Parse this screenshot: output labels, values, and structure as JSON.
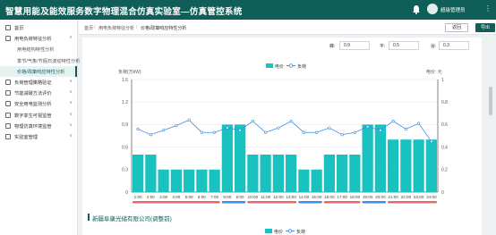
{
  "header": {
    "title": "智慧用能及能效服务数字物理混合仿真实验室—仿真管控系统",
    "user": "超级管理员",
    "bell_icon": "bell-icon",
    "more_icon": "more-icon",
    "color": "#0f5e57"
  },
  "sidebar": {
    "items": [
      {
        "label": "首页",
        "icon": "home-icon",
        "caret": "",
        "sub": false
      },
      {
        "label": "用电负荷特征分析",
        "icon": "chart-icon",
        "caret": "^",
        "sub": false
      },
      {
        "label": "用电结构特性分析",
        "icon": "",
        "caret": "",
        "sub": true
      },
      {
        "label": "季节/气象/节假日波动特性分析",
        "icon": "",
        "caret": "",
        "sub": true
      },
      {
        "label": "价格/政策响应特性分析",
        "icon": "",
        "caret": "",
        "sub": true,
        "active": true
      },
      {
        "label": "负荷管理策略验证",
        "icon": "strategy-icon",
        "caret": "v",
        "sub": false
      },
      {
        "label": "节能减碳方法评价",
        "icon": "leaf-icon",
        "caret": "v",
        "sub": false
      },
      {
        "label": "安全用电监测分析",
        "icon": "shield-icon",
        "caret": "v",
        "sub": false
      },
      {
        "label": "数字孪生可视监管",
        "icon": "monitor-icon",
        "caret": "v",
        "sub": false
      },
      {
        "label": "物理仿真环境监管",
        "icon": "server-icon",
        "caret": "v",
        "sub": false
      },
      {
        "label": "实验室管理",
        "icon": "lab-icon",
        "caret": "v",
        "sub": false
      }
    ]
  },
  "breadcrumb": {
    "items": [
      "首页",
      "用电负荷特征分析",
      "价格/政策响应特性分析"
    ]
  },
  "toolbar": {
    "back_label": "返回",
    "export_label": "导出"
  },
  "params": {
    "peak_label": "峰:",
    "peak_value": "0.9",
    "flat_label": "平:",
    "flat_value": "0.5",
    "valley_label": "谷:",
    "valley_value": "0.3"
  },
  "chart_data": {
    "type": "bar",
    "title": "",
    "left_unit": "负荷(万kW)",
    "right_unit": "电价: 元",
    "legend": [
      "电价",
      "负荷"
    ],
    "categories": [
      "1:00",
      "2:00",
      "3:00",
      "4:00",
      "5:00",
      "6:00",
      "7:00",
      "8:00",
      "9:00",
      "10:00",
      "11:00",
      "12:00",
      "13:00",
      "14:00",
      "15:00",
      "16:00",
      "17:00",
      "18:00",
      "19:00",
      "20:00",
      "21:00",
      "22:00",
      "23:00",
      "24:00"
    ],
    "series": [
      {
        "name": "电价",
        "type": "bar",
        "axis": "left",
        "color": "#19c2bf",
        "values": [
          0.5,
          0.5,
          0.3,
          0.3,
          0.3,
          0.3,
          0.3,
          0.9,
          0.9,
          0.5,
          0.5,
          0.5,
          0.5,
          0.3,
          0.3,
          0.5,
          0.5,
          0.5,
          0.9,
          0.9,
          0.7,
          0.7,
          0.7,
          0.7
        ]
      },
      {
        "name": "负荷",
        "type": "line",
        "axis": "right",
        "color": "#3a8ee6",
        "values": [
          0.56,
          0.51,
          0.55,
          0.59,
          0.64,
          0.53,
          0.53,
          0.57,
          0.55,
          0.63,
          0.53,
          0.57,
          0.63,
          0.53,
          0.53,
          0.57,
          0.51,
          0.53,
          0.58,
          0.55,
          0.63,
          0.56,
          0.61,
          0.45
        ]
      }
    ],
    "ylim": [
      0,
      1.5
    ],
    "ylim_right": [
      0,
      1.0
    ],
    "yticks": [
      "0",
      "0.3",
      "0.6",
      "0.9",
      "1.2",
      "1.5"
    ],
    "yticks_right": [
      "0",
      "0.2",
      "0.4",
      "0.6",
      "0.8",
      "1"
    ],
    "grid": true,
    "legend_position": "top-center",
    "ranges": [
      {
        "from": 0,
        "to": 6,
        "color": "#e56b6b"
      },
      {
        "from": 7,
        "to": 8,
        "color": "#3a8ee6"
      },
      {
        "from": 9,
        "to": 12,
        "color": "#e56b6b"
      },
      {
        "from": 13,
        "to": 14,
        "color": "#3a8ee6"
      },
      {
        "from": 15,
        "to": 17,
        "color": "#e56b6b"
      },
      {
        "from": 18,
        "to": 19,
        "color": "#3a8ee6"
      },
      {
        "from": 20,
        "to": 23,
        "color": "#e56b6b"
      }
    ]
  },
  "section": {
    "title": "新疆阜康光储有限公司(调整前)",
    "legend": [
      "电价",
      "负荷"
    ]
  }
}
